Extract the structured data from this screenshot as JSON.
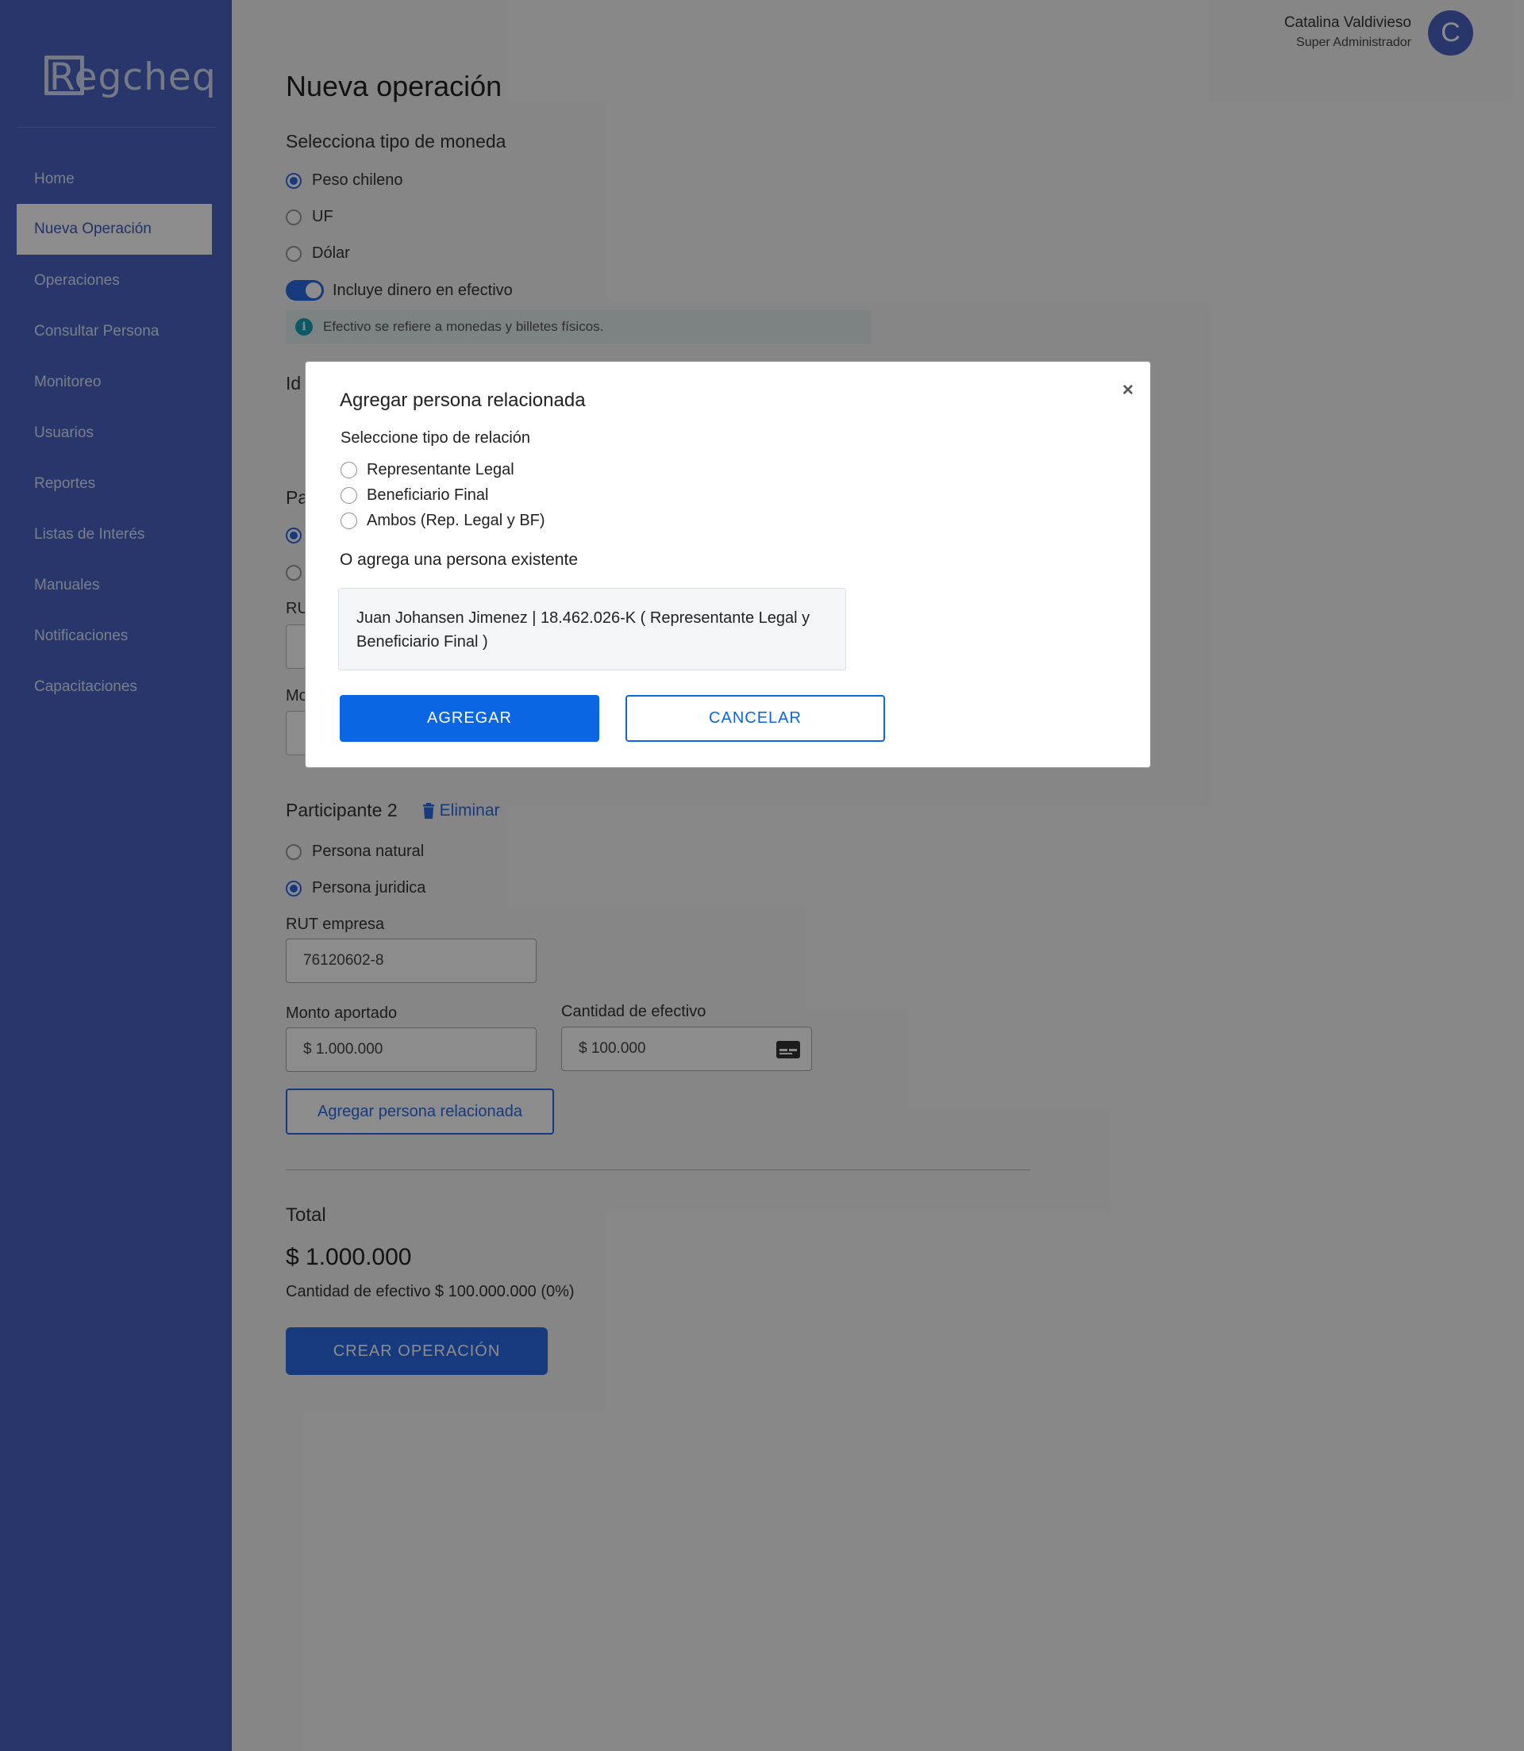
{
  "app": {
    "logo_text": "Regcheq"
  },
  "sidebar": {
    "items": [
      {
        "label": "Home"
      },
      {
        "label": "Nueva Operación"
      },
      {
        "label": "Operaciones"
      },
      {
        "label": "Consultar Persona"
      },
      {
        "label": "Monitoreo"
      },
      {
        "label": "Usuarios"
      },
      {
        "label": "Reportes"
      },
      {
        "label": "Listas de Interés"
      },
      {
        "label": "Manuales"
      },
      {
        "label": "Notificaciones"
      },
      {
        "label": "Capacitaciones"
      }
    ],
    "active_item": "Nueva Operación"
  },
  "user": {
    "name": "Catalina Valdivieso",
    "role": "Super Administrador",
    "initial": "C"
  },
  "page": {
    "title": "Nueva operación",
    "currency_label": "Selecciona tipo de moneda",
    "currency_options": [
      {
        "label": "Peso chileno",
        "checked": true
      },
      {
        "label": "UF",
        "checked": false
      },
      {
        "label": "Dólar",
        "checked": false
      }
    ],
    "cash_toggle": {
      "label": "Incluye dinero en efectivo",
      "on": true
    },
    "info_note": "Efectivo se refiere a monedas y billetes físicos.",
    "hidden_fragments": {
      "id_prefix": "Id",
      "participant_prefix": "Pa",
      "rut_prefix": "RU",
      "monto_prefix": "Mo"
    }
  },
  "participant2": {
    "title": "Participante 2",
    "delete_label": "Eliminar",
    "type_options": [
      {
        "label": "Persona natural",
        "checked": false
      },
      {
        "label": "Persona juridica",
        "checked": true
      }
    ],
    "rut_label": "RUT empresa",
    "rut_value": "76120602-8",
    "monto_label": "Monto aportado",
    "monto_value": "$ 1.000.000",
    "cash_label": "Cantidad de efectivo",
    "cash_value": "$ 100.000",
    "add_related_label": "Agregar persona relacionada"
  },
  "summary": {
    "total_label": "Total",
    "total_amount": "$ 1.000.000",
    "cash_summary": "Cantidad de efectivo $ 100.000.000 (0%)",
    "create_button": "CREAR OPERACIÓN"
  },
  "modal": {
    "title": "Agregar persona relacionada",
    "close_glyph": "×",
    "relation_label": "Seleccione tipo de relación",
    "relation_options": [
      {
        "label": "Representante Legal"
      },
      {
        "label": "Beneficiario Final"
      },
      {
        "label": "Ambos (Rep. Legal y BF)"
      }
    ],
    "existing_label": "O agrega una persona existente",
    "existing_person": "Juan Johansen Jimenez | 18.462.026-K ( Representante Legal y Beneficiario Final )",
    "add_button": "AGREGAR",
    "cancel_button": "CANCELAR"
  },
  "colors": {
    "accent": "#2b6be5",
    "sidebar": "#4a63c4",
    "modal_primary": "#0b66e4",
    "info": "#18a0b8"
  },
  "icons": {
    "info": "info-icon",
    "trash": "trash-icon",
    "card": "card-icon",
    "close": "close-icon"
  }
}
